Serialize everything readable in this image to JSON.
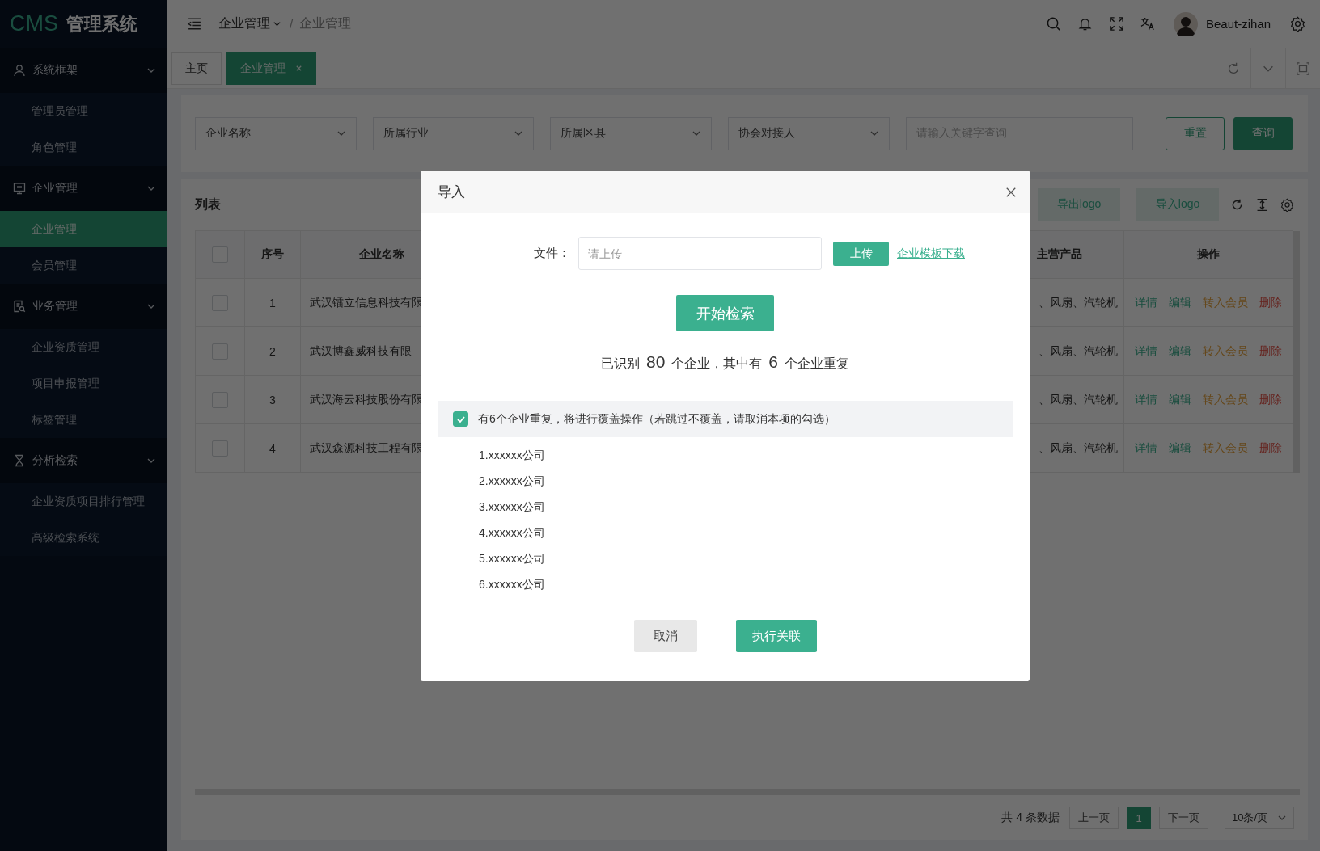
{
  "sidebar": {
    "logo": {
      "brand": "CMS",
      "title": "管理系统"
    },
    "groups": [
      {
        "label": "系统框架",
        "expanded": true,
        "items": [
          {
            "label": "管理员管理",
            "selected": false
          },
          {
            "label": "角色管理",
            "selected": false
          }
        ]
      },
      {
        "label": "企业管理",
        "expanded": true,
        "items": [
          {
            "label": "企业管理",
            "selected": true
          },
          {
            "label": "会员管理",
            "selected": false
          }
        ]
      },
      {
        "label": "业务管理",
        "expanded": true,
        "items": [
          {
            "label": "企业资质管理",
            "selected": false
          },
          {
            "label": "项目申报管理",
            "selected": false
          },
          {
            "label": "标签管理",
            "selected": false
          }
        ]
      },
      {
        "label": "分析检索",
        "expanded": true,
        "items": [
          {
            "label": "企业资质项目排行管理",
            "selected": false
          },
          {
            "label": "高级检索系统",
            "selected": false
          }
        ]
      }
    ]
  },
  "topbar": {
    "breadcrumb": [
      {
        "label": "企业管理",
        "dropdown": true
      },
      {
        "label": "企业管理",
        "dropdown": false,
        "separator": "/"
      }
    ],
    "user": {
      "name": "Beaut-zihan"
    }
  },
  "tabs": [
    {
      "label": "主页",
      "selected": false,
      "closable": false
    },
    {
      "label": "企业管理",
      "selected": true,
      "closable": true
    }
  ],
  "filters": [
    {
      "kind": "select",
      "placeholder": "企业名称"
    },
    {
      "kind": "select",
      "placeholder": "所属行业"
    },
    {
      "kind": "select",
      "placeholder": "所属区县"
    },
    {
      "kind": "select",
      "placeholder": "协会对接人"
    },
    {
      "kind": "input",
      "placeholder": "请输入关键字查询"
    }
  ],
  "filter_buttons": [
    {
      "kind": "outline",
      "label": "重置"
    },
    {
      "kind": "primary",
      "label": "查询"
    }
  ],
  "list": {
    "title": "列表",
    "toolbar_buttons": [
      "导出logo",
      "导入logo"
    ],
    "header_checked": false,
    "columns": [
      "序号",
      "企业名称",
      "主营产品",
      "操作"
    ],
    "rows": [
      {
        "checked": false,
        "index": "1",
        "name": "武汉镭立信息科技有限",
        "products": "、风扇、汽轮机",
        "actions": [
          {
            "kind": "detail",
            "label": "详情"
          },
          {
            "kind": "edit",
            "label": "编辑"
          },
          {
            "kind": "convert",
            "label": "转入会员"
          },
          {
            "kind": "delete",
            "label": "删除"
          }
        ]
      },
      {
        "checked": false,
        "index": "2",
        "name": "武汉博鑫威科技有限",
        "products": "、风扇、汽轮机",
        "actions": [
          {
            "kind": "detail",
            "label": "详情"
          },
          {
            "kind": "edit",
            "label": "编辑"
          },
          {
            "kind": "convert",
            "label": "转入会员"
          },
          {
            "kind": "delete",
            "label": "删除"
          }
        ]
      },
      {
        "checked": false,
        "index": "3",
        "name": "武汉海云科技股份有限",
        "products": "、风扇、汽轮机",
        "actions": [
          {
            "kind": "detail",
            "label": "详情"
          },
          {
            "kind": "edit",
            "label": "编辑"
          },
          {
            "kind": "convert",
            "label": "转入会员"
          },
          {
            "kind": "delete",
            "label": "删除"
          }
        ]
      },
      {
        "checked": false,
        "index": "4",
        "name": "武汉森源科技工程有限",
        "products": "、风扇、汽轮机",
        "actions": [
          {
            "kind": "detail",
            "label": "详情"
          },
          {
            "kind": "edit",
            "label": "编辑"
          },
          {
            "kind": "convert",
            "label": "转入会员"
          },
          {
            "kind": "delete",
            "label": "删除"
          }
        ]
      }
    ]
  },
  "pagination": {
    "total": "共 4 条数据",
    "prev": "上一页",
    "pages": [
      {
        "label": "1",
        "selected": true
      }
    ],
    "next": "下一页",
    "page_size": "10条/页"
  },
  "modal": {
    "title": "导入",
    "file_label": "文件：",
    "file_placeholder": "请上传",
    "upload_button": "上传",
    "template_link": "企业模板下载",
    "search_button": "开始检索",
    "summary": [
      {
        "kind": "text",
        "text": "已识别"
      },
      {
        "kind": "number",
        "text": "80"
      },
      {
        "kind": "text",
        "text": "个企业，其中有"
      },
      {
        "kind": "number",
        "text": "6"
      },
      {
        "kind": "text",
        "text": "个企业重复"
      }
    ],
    "overwrite": {
      "checked": true,
      "label": "有6个企业重复，将进行覆盖操作（若跳过不覆盖，请取消本项的勾选）"
    },
    "duplicates": [
      "1.xxxxxx公司",
      "2.xxxxxx公司",
      "3.xxxxxx公司",
      "4.xxxxxx公司",
      "5.xxxxxx公司",
      "6.xxxxxx公司"
    ],
    "buttons": [
      {
        "kind": "default",
        "label": "取消"
      },
      {
        "kind": "primary",
        "label": "执行关联"
      }
    ]
  }
}
